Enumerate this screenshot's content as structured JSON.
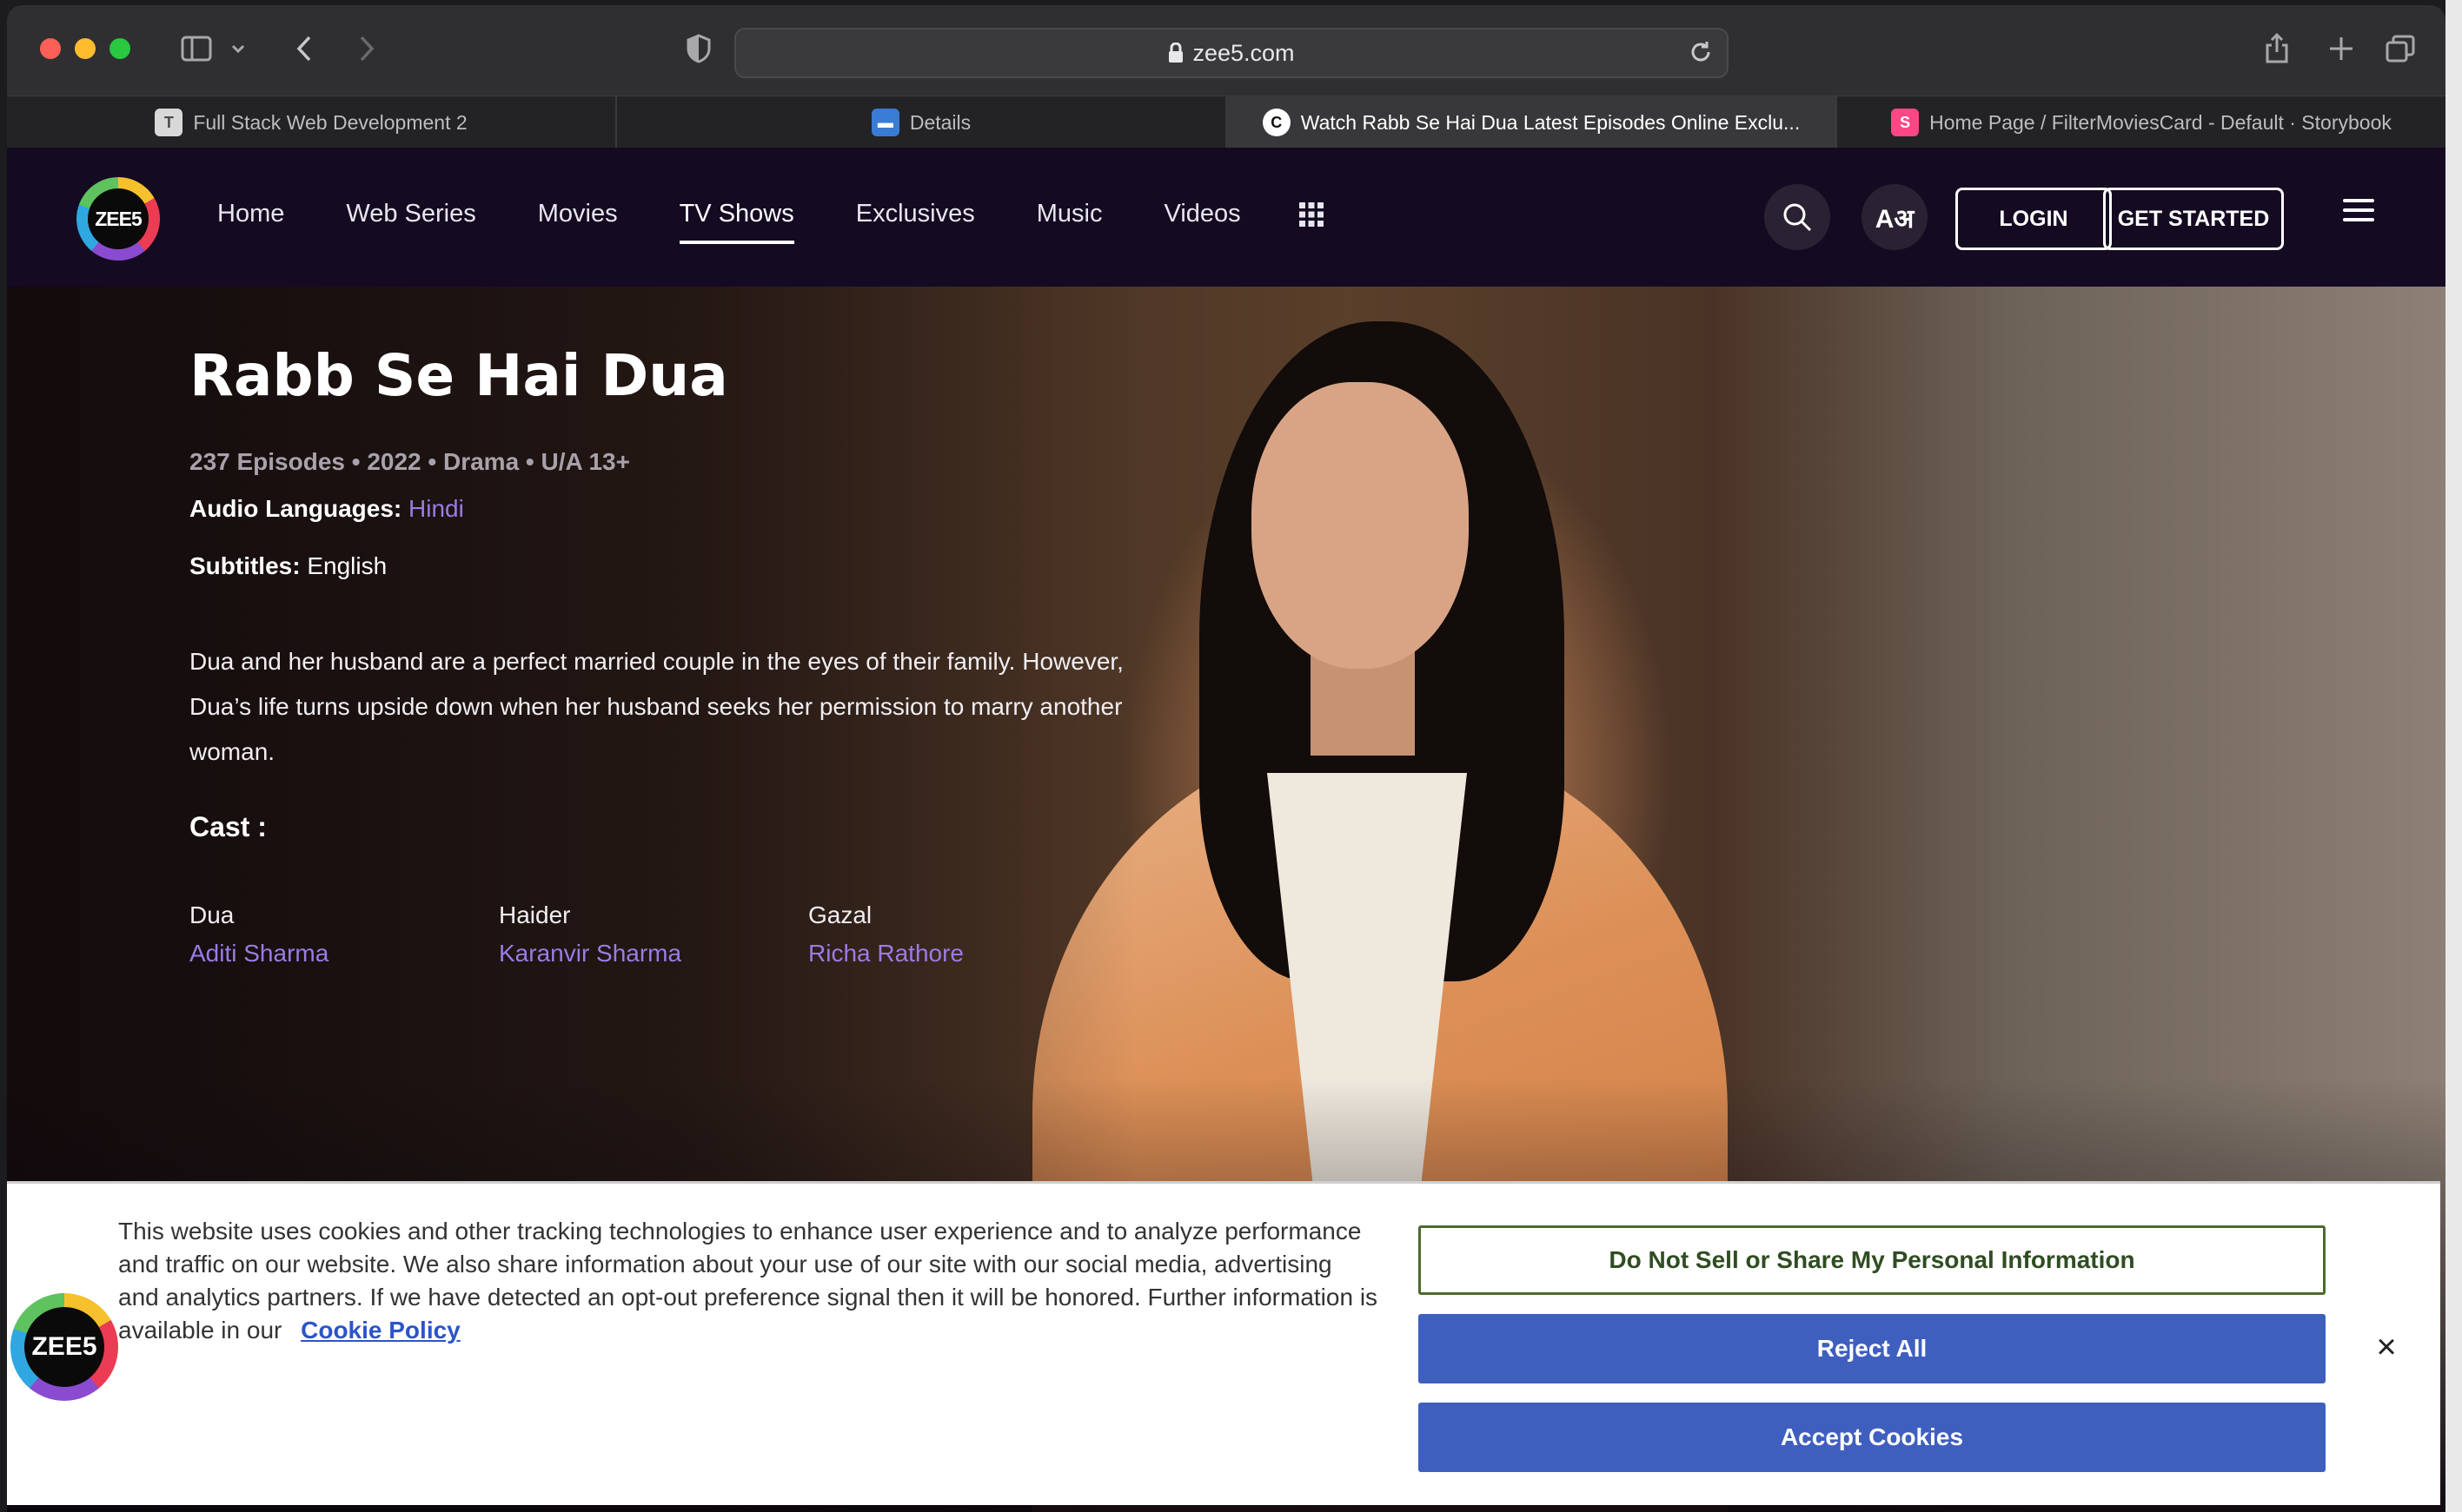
{
  "browser": {
    "url": "zee5.com",
    "tabs": [
      {
        "label": "Full Stack Web Development 2",
        "favicon": "T"
      },
      {
        "label": "Details",
        "favicon": "▬"
      },
      {
        "label": "Watch Rabb Se Hai Dua Latest Episodes Online Exclu...",
        "favicon": "C"
      },
      {
        "label": "Home Page / FilterMoviesCard - Default · Storybook",
        "favicon": "S"
      }
    ]
  },
  "site": {
    "logo_text": "ZEE5",
    "nav": [
      {
        "label": "Home"
      },
      {
        "label": "Web Series"
      },
      {
        "label": "Movies"
      },
      {
        "label": "TV Shows"
      },
      {
        "label": "Exclusives"
      },
      {
        "label": "Music"
      },
      {
        "label": "Videos"
      }
    ],
    "lang_icon_text": "Aअ",
    "login_label": "LOGIN",
    "get_started_label": "GET STARTED"
  },
  "show": {
    "title": "Rabb Se Hai Dua",
    "meta": "237 Episodes • 2022 • Drama • U/A 13+",
    "audio_label": "Audio Languages:",
    "audio_value": "Hindi",
    "subtitles_label": "Subtitles:",
    "subtitles_value": "English",
    "description": "Dua and her husband are a perfect married couple in the eyes of their family. However, Dua’s life turns upside down when her husband seeks her permission to marry another woman.",
    "cast_label": "Cast :",
    "cast": [
      {
        "role": "Dua",
        "actor": "Aditi Sharma"
      },
      {
        "role": "Haider",
        "actor": "Karanvir Sharma"
      },
      {
        "role": "Gazal",
        "actor": "Richa Rathore"
      }
    ]
  },
  "cookie": {
    "text": "This website uses cookies and other tracking technologies to enhance user experience and to analyze performance and traffic on our website. We also share information about your use of our site with our social media, advertising and analytics partners. If we have detected an opt-out preference signal then it will be honored. Further information is available in our",
    "policy_link": "Cookie Policy",
    "do_not_sell_label": "Do Not Sell or Share My Personal Information",
    "reject_label": "Reject All",
    "accept_label": "Accept Cookies",
    "close_label": "×"
  },
  "colors": {
    "accent_purple": "#9b7be6",
    "cookie_button_blue": "#3f5fbf",
    "nav_background": "#140a22"
  }
}
